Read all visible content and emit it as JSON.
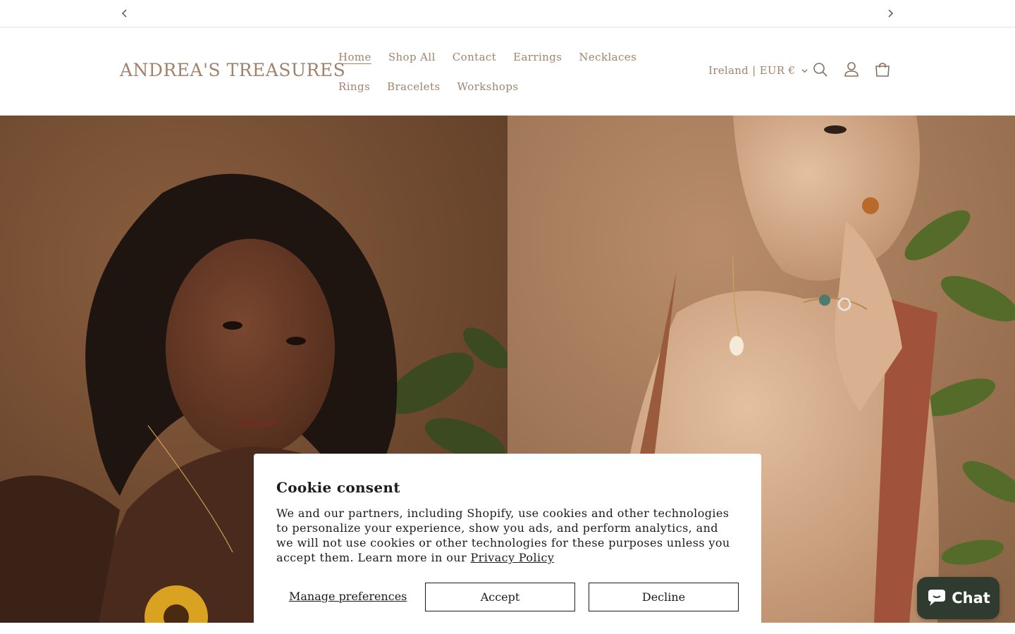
{
  "announcement": {
    "prev_icon": "chevron-left-icon",
    "next_icon": "chevron-right-icon"
  },
  "header": {
    "logo": "ANDREA'S TREASURES",
    "nav": [
      {
        "label": "Home",
        "active": true
      },
      {
        "label": "Shop All"
      },
      {
        "label": "Contact"
      },
      {
        "label": "Earrings"
      },
      {
        "label": "Necklaces"
      },
      {
        "label": "Rings"
      },
      {
        "label": "Bracelets"
      },
      {
        "label": "Workshops"
      }
    ],
    "locale": "Ireland | EUR €",
    "icons": [
      "search-icon",
      "account-icon",
      "cart-icon"
    ]
  },
  "hero": {
    "images": [
      "portrait-woman-sunflower",
      "portrait-woman-bracelet"
    ]
  },
  "cookie": {
    "title": "Cookie consent",
    "body": "We and our partners, including Shopify, use cookies and other technologies to personalize your experience, show you ads, and perform analytics, and we will not use cookies or other technologies for these purposes unless you accept them. Learn more in our ",
    "link": "Privacy Policy",
    "manage": "Manage preferences",
    "accept": "Accept",
    "decline": "Decline"
  },
  "chat": {
    "label": "Chat",
    "icon": "chat-bubble-icon"
  },
  "colors": {
    "brand_text": "#a3826c",
    "chat_bg": "#2f3b2e",
    "dark_text": "#1c1c1c"
  }
}
